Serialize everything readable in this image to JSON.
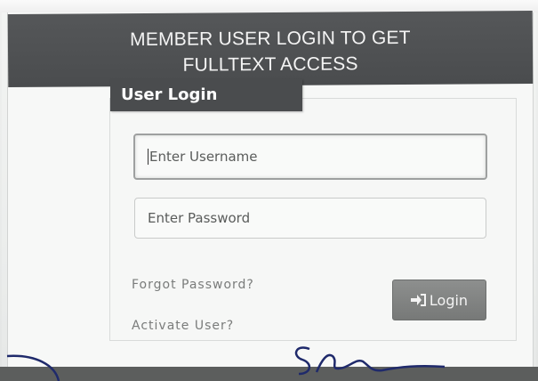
{
  "header": {
    "line1": "MEMBER USER LOGIN TO GET",
    "line2": "FULLTEXT ACCESS"
  },
  "login": {
    "tab_label": "User Login",
    "username_placeholder": "Enter Username",
    "password_placeholder": "Enter Password",
    "forgot_label": "Forgot Password?",
    "activate_label": "Activate User?",
    "button_label": "Login",
    "button_icon": "sign-in-icon"
  },
  "colors": {
    "header_bg": "#4a4c4e",
    "button_bg": "#808281",
    "link_text": "#7a7c7b"
  }
}
